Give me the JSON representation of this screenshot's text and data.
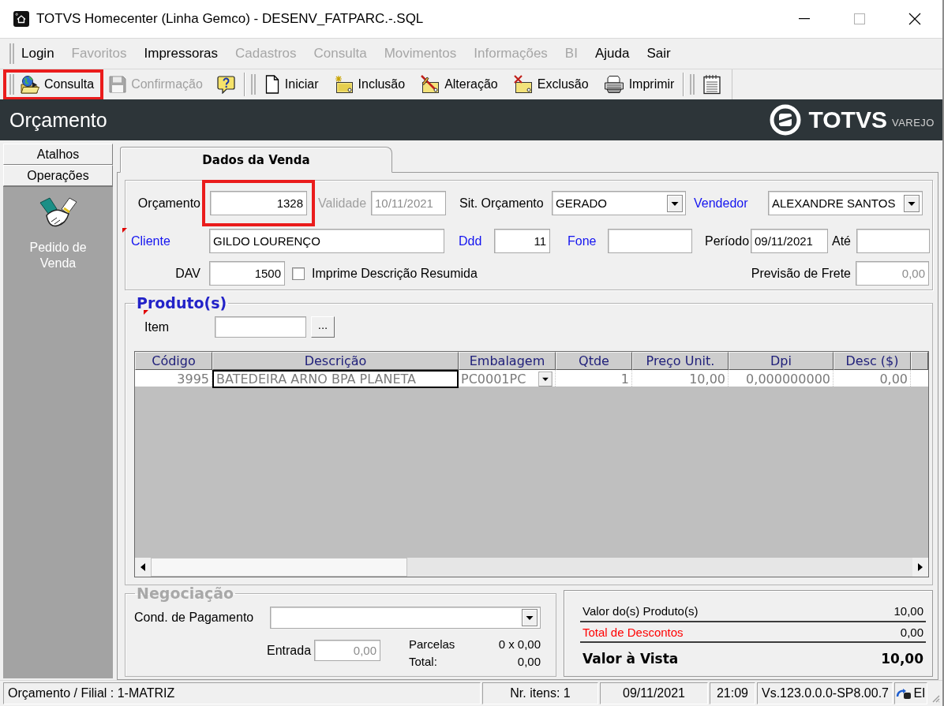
{
  "window": {
    "title": "TOTVS Homecenter (Linha Gemco) - DESENV_FATPARC.-.SQL"
  },
  "menu": [
    {
      "label": "Login",
      "disabled": false
    },
    {
      "label": "Favoritos",
      "disabled": true
    },
    {
      "label": "Impressoras",
      "disabled": false
    },
    {
      "label": "Cadastros",
      "disabled": true
    },
    {
      "label": "Consulta",
      "disabled": true
    },
    {
      "label": "Movimentos",
      "disabled": true
    },
    {
      "label": "Informações",
      "disabled": true
    },
    {
      "label": "BI",
      "disabled": true
    },
    {
      "label": "Ajuda",
      "disabled": false
    },
    {
      "label": "Sair",
      "disabled": false
    }
  ],
  "toolbar": [
    {
      "kind": "button",
      "label": "Consulta",
      "disabled": false,
      "highlighted": true
    },
    {
      "kind": "button",
      "label": "Confirmação",
      "disabled": true,
      "highlighted": false
    },
    {
      "kind": "icon",
      "disabled": false,
      "highlighted": false
    },
    {
      "kind": "separator"
    },
    {
      "kind": "button",
      "label": "Iniciar",
      "disabled": false,
      "highlighted": false
    },
    {
      "kind": "button",
      "label": "Inclusão",
      "disabled": false,
      "highlighted": false
    },
    {
      "kind": "button",
      "label": "Alteração",
      "disabled": false,
      "highlighted": false
    },
    {
      "kind": "button",
      "label": "Exclusão",
      "disabled": false,
      "highlighted": false
    },
    {
      "kind": "button",
      "label": "Imprimir",
      "disabled": false,
      "highlighted": false
    },
    {
      "kind": "separator"
    },
    {
      "kind": "icon",
      "disabled": false,
      "highlighted": false
    }
  ],
  "header": {
    "title": "Orçamento",
    "logo": {
      "name": "TOTVS",
      "tagline": "VAREJO"
    }
  },
  "sidebar": {
    "sections": [
      {
        "label": "Atalhos"
      },
      {
        "label": "Operações"
      }
    ],
    "shortcuts": [
      {
        "label": "Pedido de Venda"
      }
    ]
  },
  "tabs": [
    {
      "label": "Dados da Venda",
      "selected": true
    }
  ],
  "sale": {
    "orcamento": {
      "label": "Orçamento",
      "value": "1328",
      "highlighted": true,
      "lookup": false,
      "required": false,
      "disabled": false,
      "readonly": false
    },
    "validade": {
      "label": "Validade",
      "value": "10/11/2021",
      "lookup": false,
      "required": false,
      "disabled": true
    },
    "situacao": {
      "label": "Sit. Orçamento",
      "value": "GERADO",
      "lookup": false,
      "required": false,
      "disabled": false,
      "readonly": false
    },
    "vendedor": {
      "label": "Vendedor",
      "value": "ALEXANDRE SANTOS",
      "lookup": true,
      "required": false,
      "disabled": false,
      "readonly": false
    },
    "cliente": {
      "label": "Cliente",
      "value": "GILDO LOURENÇO",
      "lookup": true,
      "required": true,
      "disabled": false,
      "readonly": false
    },
    "ddd": {
      "label": "Ddd",
      "value": "11",
      "lookup": true,
      "required": false,
      "disabled": false,
      "readonly": false
    },
    "fone": {
      "label": "Fone",
      "lookup": true,
      "required": false,
      "disabled": false
    },
    "periodo": {
      "label": "Período",
      "value": "09/11/2021",
      "lookup": false,
      "required": false,
      "disabled": false,
      "readonly": false
    },
    "ate": {
      "label": "Até",
      "lookup": false,
      "required": false,
      "disabled": false
    },
    "dav": {
      "label": "DAV",
      "value": "1500",
      "lookup": false,
      "required": false,
      "disabled": false,
      "readonly": false
    },
    "imprime_resumida": {
      "label": "Imprime Descrição Resumida",
      "checked": false
    },
    "previsao_frete": {
      "label": "Previsão de Frete",
      "value": "0,00",
      "lookup": false,
      "required": false,
      "disabled": false,
      "readonly": true
    }
  },
  "products": {
    "title": "Produto(s)",
    "disabled": false,
    "item": {
      "label": "Item",
      "required": true,
      "browse": "..."
    },
    "columns": [
      "Código",
      "Descrição",
      "Embalagem",
      "Qtde",
      "Preço Unit.",
      "Dpi",
      "Desc ($)"
    ],
    "rows": [
      {
        "cells": [
          {
            "kind": "text",
            "text": "3995",
            "focused": false
          },
          {
            "kind": "text",
            "text": "BATEDEIRA ARNO BPA PLANETA",
            "focused": true
          },
          {
            "kind": "dropdown",
            "text": "PC0001PC",
            "focused": false
          },
          {
            "kind": "text",
            "text": "1",
            "focused": false
          },
          {
            "kind": "text",
            "text": "10,00",
            "focused": false
          },
          {
            "kind": "text",
            "text": "0,000000000",
            "focused": false
          },
          {
            "kind": "text",
            "text": "0,00",
            "focused": false
          }
        ]
      }
    ]
  },
  "negotiation": {
    "title": "Negociação",
    "disabled": true,
    "payment_condition": {
      "label": "Cond. de Pagamento"
    },
    "entry": {
      "label": "Entrada",
      "value": "0,00",
      "readonly": true
    },
    "installments": {
      "label": "Parcelas",
      "value": "0 x 0,00"
    },
    "total": {
      "label": "Total:",
      "value": "0,00"
    }
  },
  "totals": [
    {
      "kind": "subtotal",
      "label": "Valor do(s) Produto(s)",
      "value": "10,00"
    },
    {
      "kind": "discount",
      "label": "Total de Descontos",
      "value": "0,00"
    },
    {
      "kind": "grand",
      "label": "Valor à Vista",
      "value": "10,00"
    }
  ],
  "status_bar": [
    {
      "kind": "text",
      "text": "Orçamento / Filial : 1-MATRIZ"
    },
    {
      "kind": "text",
      "text": "Nr. itens: 1"
    },
    {
      "kind": "text",
      "text": "09/11/2021"
    },
    {
      "kind": "text",
      "text": "21:09"
    },
    {
      "kind": "text",
      "text": "Vs.123.0.0.0-SP8.00.7"
    },
    {
      "kind": "icon_text",
      "text": "EI"
    }
  ]
}
